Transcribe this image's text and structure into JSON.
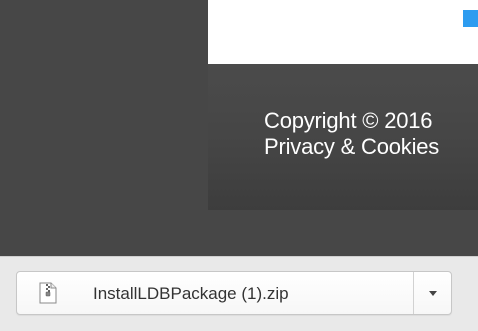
{
  "footer": {
    "copyright_text": "Copyright © 2016",
    "privacy_text": "Privacy & Cookies"
  },
  "download_bar": {
    "file_name": "InstallLDBPackage (1).zip",
    "file_icon": "zip-file-icon",
    "menu_icon": "chevron-down-icon"
  },
  "colors": {
    "accent_blue": "#2d9cf0",
    "page_dark": "#474747",
    "footer_text": "#ffffff",
    "download_bar_bg": "#e9e9e9"
  }
}
